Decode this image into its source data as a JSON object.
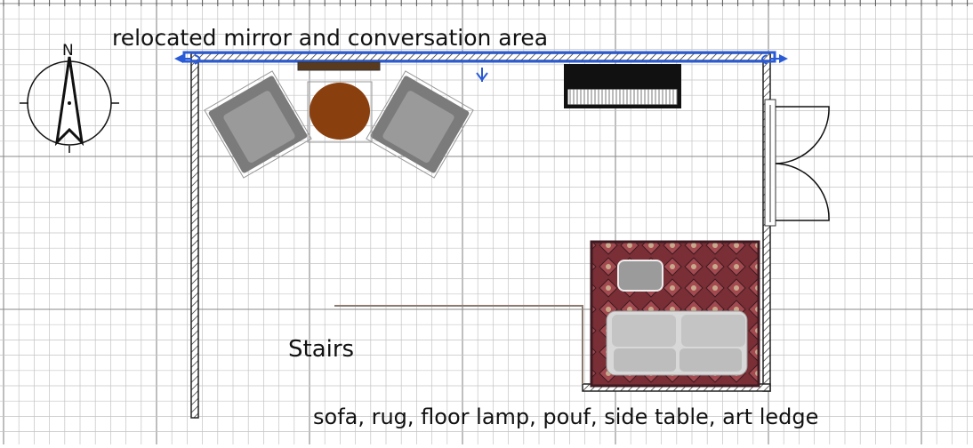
{
  "floorplan": {
    "labels": {
      "top_note": "relocated mirror and conversation area",
      "stairs": "Stairs",
      "bottom_note": "sofa, rug, floor lamp, pouf, side table, art ledge"
    },
    "compass": {
      "north_letter": "N",
      "icon": "compass-icon"
    },
    "colors": {
      "grid": "#c4c4c4",
      "grid_major": "#8a8a8a",
      "wall": "#222222",
      "selection": "#2a5bd7",
      "chair": "#8c8c8c",
      "table": "#8a3f0f",
      "rug": "#7a2e35",
      "sofa": "#cfcfcf",
      "piano": "#111111"
    },
    "icons": [
      "compass-icon",
      "armchair-icon",
      "round-table-icon",
      "piano-icon",
      "double-door-icon",
      "rug-icon",
      "sofa-icon",
      "pouf-icon",
      "mirror-icon"
    ]
  }
}
